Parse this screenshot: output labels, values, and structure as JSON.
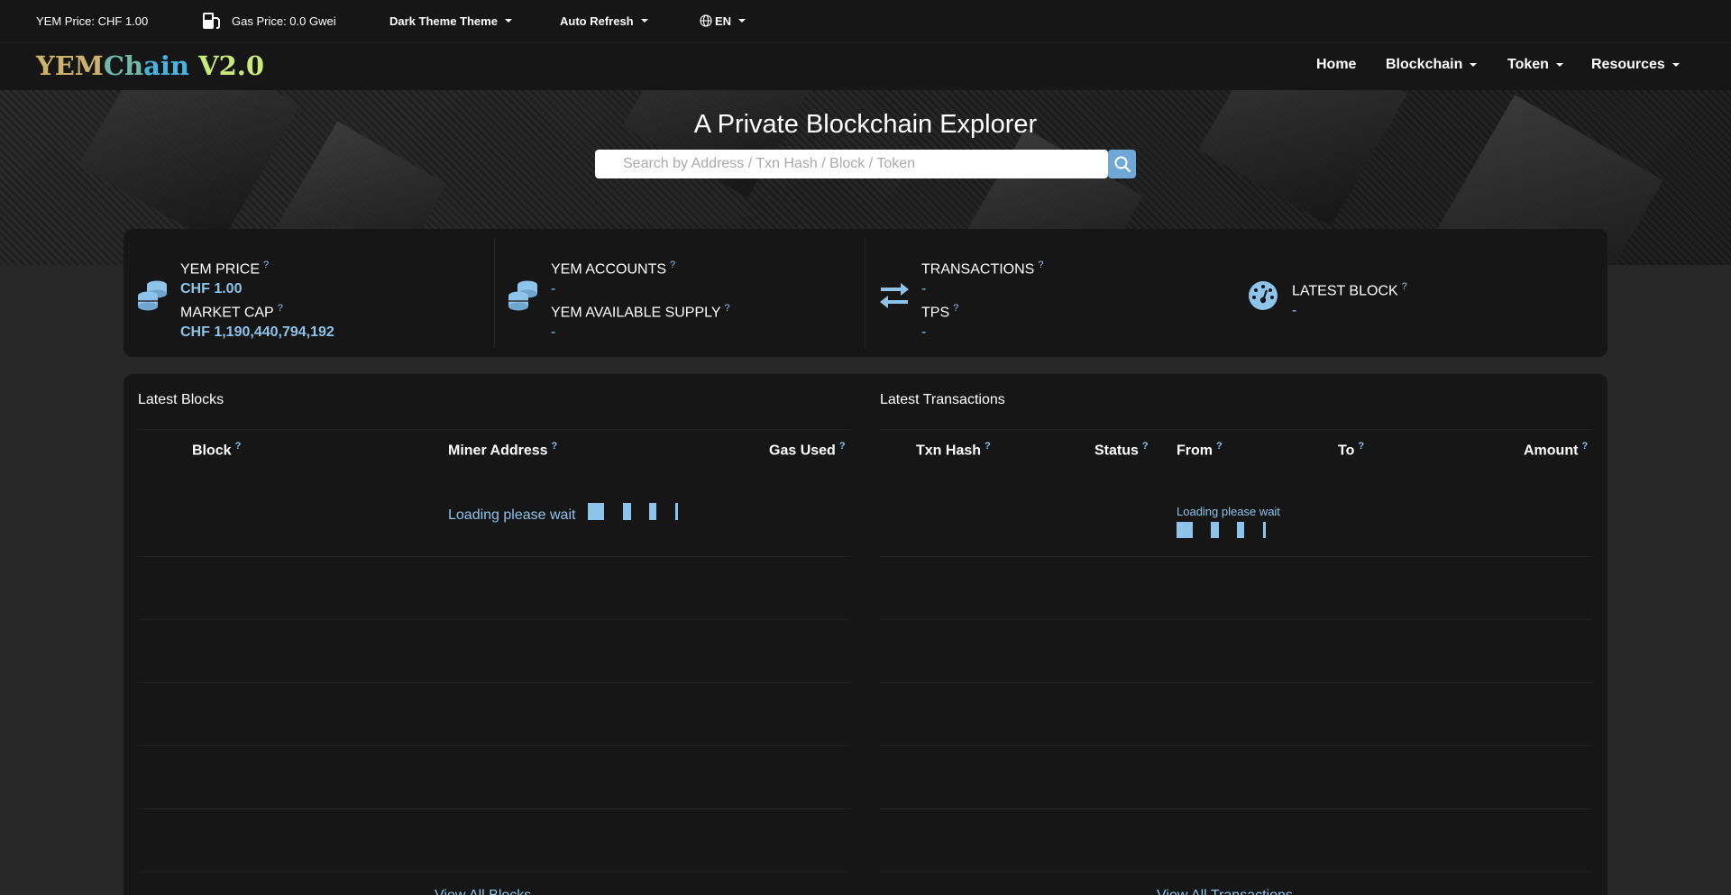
{
  "topbar": {
    "price": "YEM Price: CHF 1.00",
    "gas": "Gas Price: 0.0 Gwei",
    "theme": "Dark Theme Theme",
    "refresh": "Auto Refresh",
    "language": "EN"
  },
  "navbar": {
    "logo_part1": "YEM",
    "logo_part2": "Ch",
    "logo_part3": "ain",
    "logo_part4": " V2.0",
    "items": [
      "Home",
      "Blockchain",
      "Token",
      "Resources"
    ]
  },
  "hero": {
    "title": "A Private Blockchain Explorer",
    "search_placeholder": "Search by Address / Txn Hash / Block / Token"
  },
  "stats": {
    "price_label": "YEM PRICE",
    "price_value": "CHF 1.00",
    "marketcap_label": "MARKET CAP",
    "marketcap_value": "CHF 1,190,440,794,192",
    "accounts_label": "YEM ACCOUNTS",
    "accounts_value": "-",
    "supply_label": "YEM AVAILABLE SUPPLY",
    "supply_value": "-",
    "transactions_label": "TRANSACTIONS",
    "transactions_value": "-",
    "tps_label": "TPS",
    "tps_value": "-",
    "latest_block_label": "LATEST BLOCK",
    "latest_block_value": "-",
    "help": "?"
  },
  "blocks": {
    "title": "Latest Blocks",
    "columns": [
      "Block",
      "Miner Address",
      "Gas Used"
    ],
    "loading": "Loading please wait",
    "view_all": "View All Blocks"
  },
  "transactions": {
    "title": "Latest Transactions",
    "columns": [
      "Txn Hash",
      "Status",
      "From",
      "To",
      "Amount"
    ],
    "loading": "Loading please wait",
    "view_all": "View All Transactions"
  },
  "colors": {
    "accent": "#8ec3ea",
    "background": "#272727",
    "card": "#161616"
  }
}
